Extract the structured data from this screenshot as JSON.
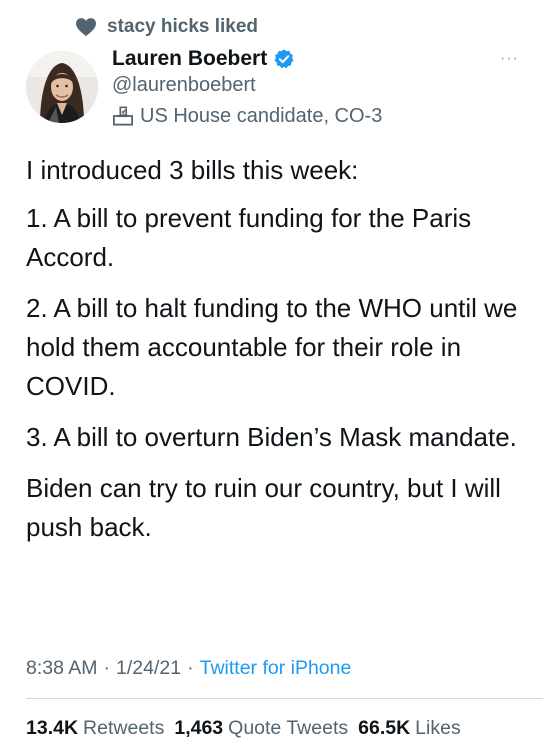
{
  "social_context": {
    "text": "stacy hicks liked",
    "icon": "heart-icon"
  },
  "author": {
    "display_name": "Lauren Boebert",
    "handle": "@laurenboebert",
    "label": "US House candidate, CO-3",
    "label_icon": "ballot-box-icon",
    "verified": true,
    "verified_color": "#1d9bf0"
  },
  "more_button": "···",
  "tweet": {
    "paragraphs": [
      "I introduced 3 bills this week:",
      "1. A bill to prevent funding for the Paris Accord.",
      "2. A bill to halt funding to the WHO until we hold them accountable for their role in COVID.",
      "3. A bill to overturn Biden’s Mask mandate.",
      "Biden can try to ruin our country, but I will push back."
    ]
  },
  "meta": {
    "time": "8:38 AM",
    "separator": "·",
    "date": "1/24/21",
    "source": "Twitter for iPhone"
  },
  "stats": {
    "retweets_count": "13.4K",
    "retweets_label": "Retweets",
    "quotes_count": "1,463",
    "quotes_label": "Quote Tweets",
    "likes_count": "66.5K",
    "likes_label": "Likes"
  },
  "colors": {
    "link": "#1d9bf0",
    "secondary_text": "#536471",
    "primary_text": "#0f1419",
    "divider": "#cfd9de"
  }
}
